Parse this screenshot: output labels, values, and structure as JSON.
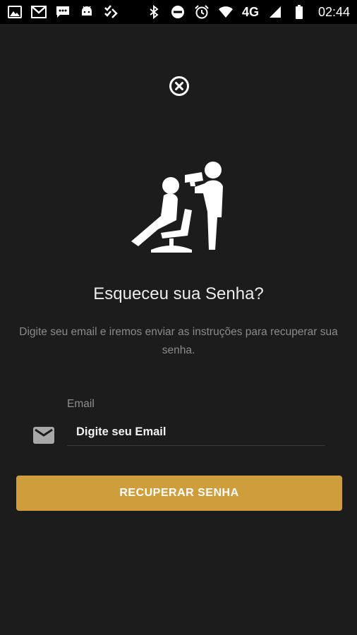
{
  "status_bar": {
    "time": "02:44",
    "network": "4G",
    "left_icons": [
      "gallery-icon",
      "gmail-icon",
      "sms-icon",
      "android-icon",
      "checklist-icon"
    ],
    "right_icons": [
      "bluetooth-icon",
      "do-not-disturb-icon",
      "alarm-icon",
      "wifi-icon",
      "signal-icon",
      "battery-icon"
    ]
  },
  "screen": {
    "close_icon": "close-circle-icon",
    "illustration": "barber-haircut-icon",
    "title": "Esqueceu sua Senha?",
    "subtitle": "Digite seu email e iremos enviar as instruções para recuperar sua senha."
  },
  "form": {
    "email_label": "Email",
    "email_placeholder": "Digite seu Email",
    "email_value": "",
    "email_icon": "mail-icon",
    "submit_label": "RECUPERAR SENHA"
  },
  "colors": {
    "background": "#1c1c1c",
    "accent": "#cd9e3b",
    "status_bar": "#000000"
  }
}
